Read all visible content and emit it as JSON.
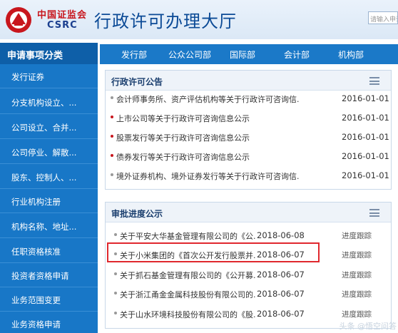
{
  "header": {
    "logo_cn": "中国证监会",
    "logo_en": "CSRC",
    "title": "行政许可办理大厅",
    "search_placeholder": "请输入申请"
  },
  "nav": {
    "items": [
      "发行部",
      "公众公司部",
      "国际部",
      "会计部",
      "机构部"
    ]
  },
  "sidebar": {
    "heading": "申请事项分类",
    "items": [
      "发行证券",
      "分支机构设立、...",
      "公司设立、合并...",
      "公司停业、解散...",
      "股东、控制人、...",
      "行业机构注册",
      "机构名称、地址...",
      "任职资格核准",
      "投资者资格申请",
      "业务范围变更",
      "业务资格申请"
    ]
  },
  "announcements": {
    "title": "行政许可公告",
    "rows": [
      {
        "text": "会计师事务所、资产评估机构等关于行政许可咨询信.",
        "date": "2016-01-01",
        "bullet": "#999999"
      },
      {
        "text": "上市公司等关于行政许可咨询信息公示",
        "date": "2016-01-01",
        "bullet": "#c8161d"
      },
      {
        "text": "股票发行等关于行政许可咨询信息公示",
        "date": "2016-01-01",
        "bullet": "#c8161d"
      },
      {
        "text": "债券发行等关于行政许可咨询信息公示",
        "date": "2016-01-01",
        "bullet": "#c8161d"
      },
      {
        "text": "境外证券机构、境外证券发行等关于行政许可咨询信.",
        "date": "2016-01-01",
        "bullet": "#999999"
      }
    ]
  },
  "progress": {
    "title": "审批进度公示",
    "rows": [
      {
        "text": "关于平安大华基金管理有限公司的《公.",
        "date": "2018-06-08",
        "status": "进度跟踪"
      },
      {
        "text": "关于小米集团的《首次公开发行股票并.",
        "date": "2018-06-07",
        "status": "进度跟踪"
      },
      {
        "text": "关于抓石基金管理有限公司的《公开募.",
        "date": "2018-06-07",
        "status": "进度跟踪"
      },
      {
        "text": "关于浙江甬金金属科技股份有限公司的.",
        "date": "2018-06-07",
        "status": "进度跟踪"
      },
      {
        "text": "关于山水环境科技股份有限公司的《股.",
        "date": "2018-06-07",
        "status": "进度跟踪"
      }
    ]
  },
  "watermark": "头条 @悟空问答",
  "colors": {
    "nav_blue": "#1b79c8",
    "highlight_red": "#e0282e",
    "logo_red": "#c8161d"
  }
}
